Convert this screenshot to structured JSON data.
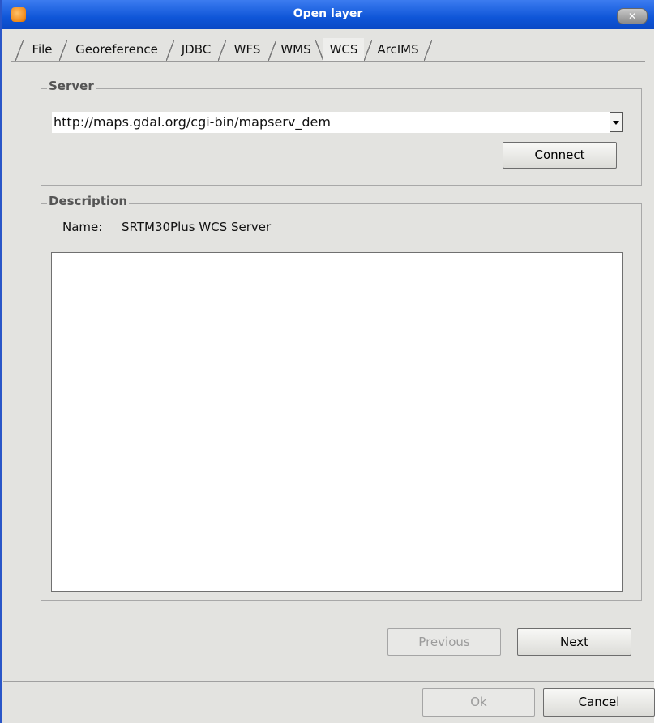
{
  "window": {
    "title": "Open layer",
    "close_icon": "close-x-icon",
    "app_icon": "gvsig-app-icon"
  },
  "tabs": [
    {
      "label": "File"
    },
    {
      "label": "Georeference"
    },
    {
      "label": "JDBC"
    },
    {
      "label": "WFS"
    },
    {
      "label": "WMS"
    },
    {
      "label": "WCS",
      "active": true
    },
    {
      "label": "ArcIMS"
    }
  ],
  "server": {
    "group_title": "Server",
    "url": "http://maps.gdal.org/cgi-bin/mapserv_dem",
    "connect_label": "Connect"
  },
  "description": {
    "group_title": "Description",
    "name_label": "Name:",
    "name_value": "SRTM30Plus WCS Server",
    "text": ""
  },
  "wizard": {
    "previous_label": "Previous",
    "next_label": "Next"
  },
  "footer": {
    "ok_label": "Ok",
    "cancel_label": "Cancel"
  },
  "colors": {
    "titlebar": "#0f56d8",
    "window_bg": "#e3e3e0"
  }
}
